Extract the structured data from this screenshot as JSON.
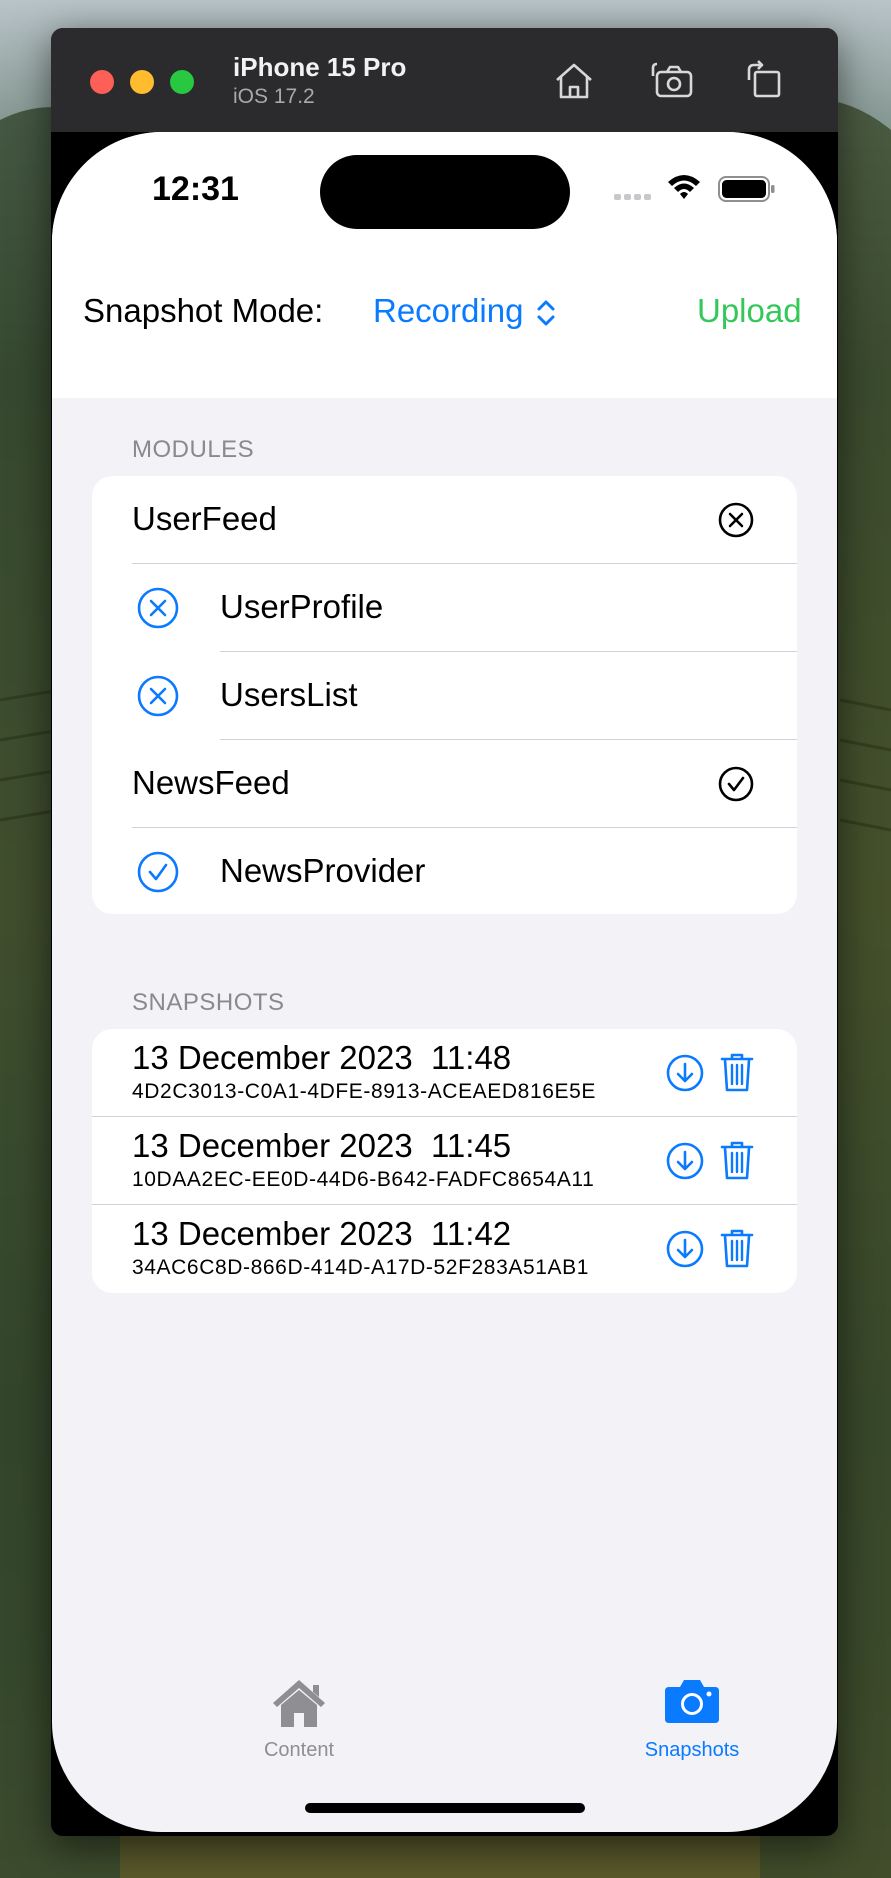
{
  "window": {
    "device_name": "iPhone 15 Pro",
    "os_version": "iOS 17.2",
    "toolbar_icons": [
      "home-icon",
      "screenshot-icon",
      "rotate-icon"
    ]
  },
  "status_bar": {
    "time": "12:31",
    "icons": [
      "cellular-signal-icon",
      "wifi-icon",
      "battery-icon"
    ]
  },
  "header": {
    "mode_label": "Snapshot Mode:",
    "mode_value": "Recording",
    "upload_label": "Upload"
  },
  "modules": {
    "section_title": "MODULES",
    "items": [
      {
        "name": "UserFeed",
        "level": 0,
        "state": "excluded",
        "icon": "xmark-circle-icon"
      },
      {
        "name": "UserProfile",
        "level": 1,
        "state": "excluded",
        "icon": "xmark-circle-icon"
      },
      {
        "name": "UsersList",
        "level": 1,
        "state": "excluded",
        "icon": "xmark-circle-icon"
      },
      {
        "name": "NewsFeed",
        "level": 0,
        "state": "included",
        "icon": "checkmark-circle-icon"
      },
      {
        "name": "NewsProvider",
        "level": 1,
        "state": "included",
        "icon": "checkmark-circle-icon"
      }
    ]
  },
  "snapshots": {
    "section_title": "SNAPSHOTS",
    "items": [
      {
        "date": "13 December 2023  11:48",
        "id": "4D2C3013-C0A1-4DFE-8913-ACEAED816E5E"
      },
      {
        "date": "13 December 2023  11:45",
        "id": "10DAA2EC-EE0D-44D6-B642-FADFC8654A11"
      },
      {
        "date": "13 December 2023  11:42",
        "id": "34AC6C8D-866D-414D-A17D-52F283A51AB1"
      }
    ],
    "action_icons": [
      "download-icon",
      "trash-icon"
    ]
  },
  "tab_bar": {
    "tabs": [
      {
        "label": "Content",
        "icon": "house-icon",
        "selected": false
      },
      {
        "label": "Snapshots",
        "icon": "camera-icon",
        "selected": true
      }
    ]
  },
  "colors": {
    "accent": "#0a7aff",
    "upload": "#34c759",
    "tab_inactive": "#8e8e93",
    "separator": "#d1d1d6",
    "grouped_background": "#f2f2f7"
  }
}
